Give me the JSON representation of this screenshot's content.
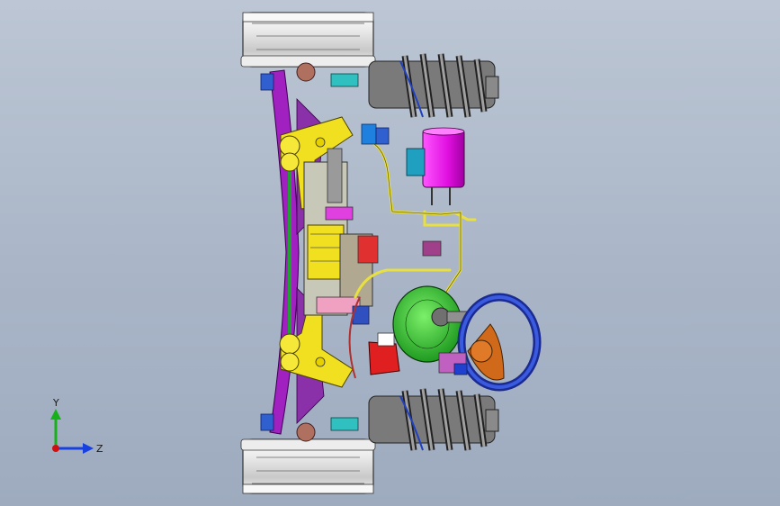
{
  "viewport": {
    "background_top": "#bcc6d4",
    "background_bottom": "#9eabbf"
  },
  "triad": {
    "y_label": "Y",
    "z_label": "Z",
    "x_color": "#d01010",
    "y_color": "#18b018",
    "z_color": "#1840e0"
  },
  "model": {
    "icon": "chassis-assembly-icon"
  }
}
